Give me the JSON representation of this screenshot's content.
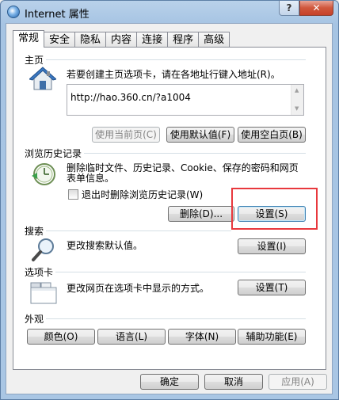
{
  "window": {
    "title": "Internet 属性",
    "help_label": "?",
    "close_label": "✕"
  },
  "tabs": [
    {
      "label": "常规",
      "active": true
    },
    {
      "label": "安全"
    },
    {
      "label": "隐私"
    },
    {
      "label": "内容"
    },
    {
      "label": "连接"
    },
    {
      "label": "程序"
    },
    {
      "label": "高级"
    }
  ],
  "home": {
    "title": "主页",
    "desc": "若要创建主页选项卡，请在各地址行键入地址(R)。",
    "url": "http://hao.360.cn/?a1004",
    "btn_current": "使用当前页(C)",
    "btn_default": "使用默认值(F)",
    "btn_blank": "使用空白页(B)"
  },
  "history": {
    "title": "浏览历史记录",
    "desc_line1": "删除临时文件、历史记录、Cookie、保存的密码和网页",
    "desc_line2": "表单信息。",
    "checkbox_label": "退出时删除浏览历史记录(W)",
    "btn_delete": "删除(D)...",
    "btn_settings": "设置(S)"
  },
  "search": {
    "title": "搜索",
    "desc": "更改搜索默认值。",
    "btn_settings": "设置(I)"
  },
  "tabs_section": {
    "title": "选项卡",
    "desc": "更改网页在选项卡中显示的方式。",
    "btn_settings": "设置(T)"
  },
  "appearance": {
    "title": "外观",
    "btn_colors": "颜色(O)",
    "btn_languages": "语言(L)",
    "btn_fonts": "字体(N)",
    "btn_accessibility": "辅助功能(E)"
  },
  "footer": {
    "ok": "确定",
    "cancel": "取消",
    "apply": "应用(A)"
  }
}
